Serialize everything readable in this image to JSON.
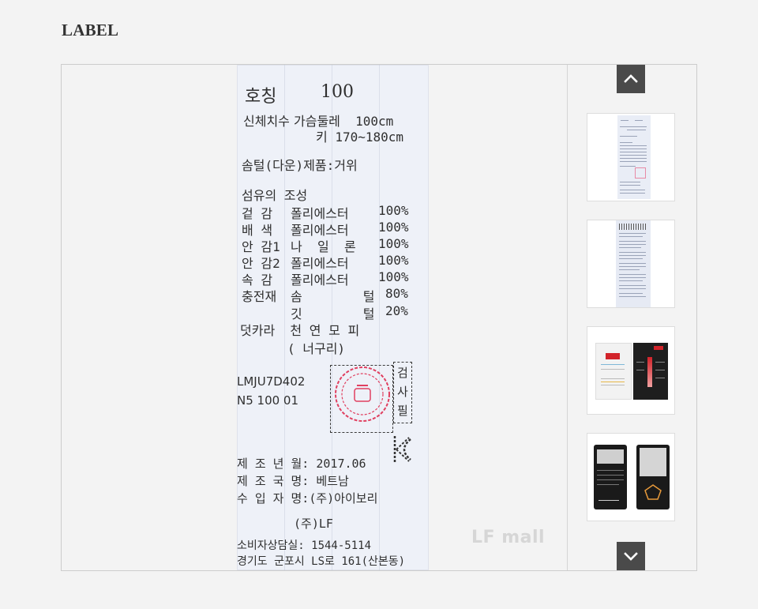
{
  "section": {
    "title": "LABEL"
  },
  "label": {
    "size_label": "호칭",
    "size_value": "100",
    "body_size_label": "신체치수",
    "chest_line": "가슴둘레  100cm",
    "height_line": "키 170~180cm",
    "down_product": "솜털(다운)제품:거위",
    "fiber_title": "섬유의 조성",
    "fiber_rows": [
      {
        "part": "겉 감",
        "material": "폴리에스터",
        "pct": "100%"
      },
      {
        "part": "배 색",
        "material": "폴리에스터",
        "pct": "100%"
      },
      {
        "part": "안 감1",
        "material": "나  일  론",
        "pct": "100%"
      },
      {
        "part": "안 감2",
        "material": "폴리에스터",
        "pct": "100%"
      },
      {
        "part": "속 감",
        "material": "폴리에스터",
        "pct": "100%"
      },
      {
        "part": "충전재",
        "material": "솜        털",
        "pct": "80%"
      },
      {
        "part": "",
        "material": "깃        털",
        "pct": "20%"
      }
    ],
    "collar_line": "덧카라  천 연 모 피",
    "collar_sub": "( 너구리)",
    "style_code": "LMJU7D402",
    "style_code2": "N5 100 01",
    "inspection": "검사필",
    "mfg_date": "제 조 년 월: 2017.06",
    "mfg_country": "제 조 국 명: 베트남",
    "importer": "수 입 자 명:(주)아이보리",
    "company": "(주)LF",
    "consumer_center": "소비자상담실: 1544-5114",
    "address": "경기도 군포시 LS로 161(산본동)"
  },
  "watermark": {
    "text": "LF mall"
  },
  "thumbnails": [
    {
      "name": "care-label-front"
    },
    {
      "name": "care-label-back"
    },
    {
      "name": "3m-thinsulate-tag"
    },
    {
      "name": "goose-down-tag"
    }
  ],
  "controls": {
    "up_icon": "chevron-up-icon",
    "down_icon": "chevron-down-icon"
  },
  "colors": {
    "arrow_bg": "#4a4a4a",
    "label_bg": "#eef1f8",
    "stamp_red": "#e04060"
  }
}
